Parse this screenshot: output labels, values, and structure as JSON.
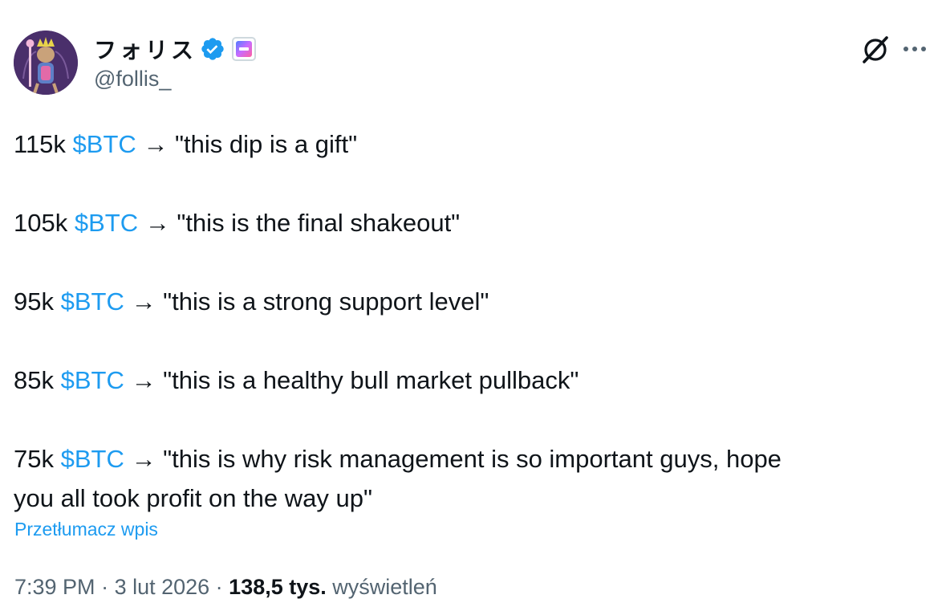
{
  "author": {
    "display_name": "フォリス",
    "handle": "@follis_",
    "verified_badge_color": "#1d9bf0",
    "avatar_background": "#4a2f6b"
  },
  "header_icons": {
    "grok": "grok-icon",
    "more": "more-icon"
  },
  "tweet": {
    "lines": [
      {
        "prefix": "115k ",
        "cashtag": "$BTC",
        "suffix": " → \"this dip is a gift\""
      },
      {
        "prefix": "105k ",
        "cashtag": "$BTC",
        "suffix": " → \"this is the final shakeout\""
      },
      {
        "prefix": "95k ",
        "cashtag": "$BTC",
        "suffix": " → \"this is a strong support level\""
      },
      {
        "prefix": "85k ",
        "cashtag": "$BTC",
        "suffix": " → \"this is a healthy bull market pullback\""
      },
      {
        "prefix": "75k ",
        "cashtag": "$BTC",
        "suffix": " → \"this is why risk management is so important guys, hope",
        "continuation": "you all took profit on the way up\""
      }
    ],
    "translate_label": "Przetłumacz wpis"
  },
  "meta": {
    "time": "7:39 PM",
    "separator": " · ",
    "date": "3 lut 2026",
    "views_count": "138,5 tys.",
    "views_label": " wyświetleń"
  },
  "colors": {
    "link": "#1d9bf0",
    "text": "#0f1419",
    "secondary": "#536471"
  }
}
